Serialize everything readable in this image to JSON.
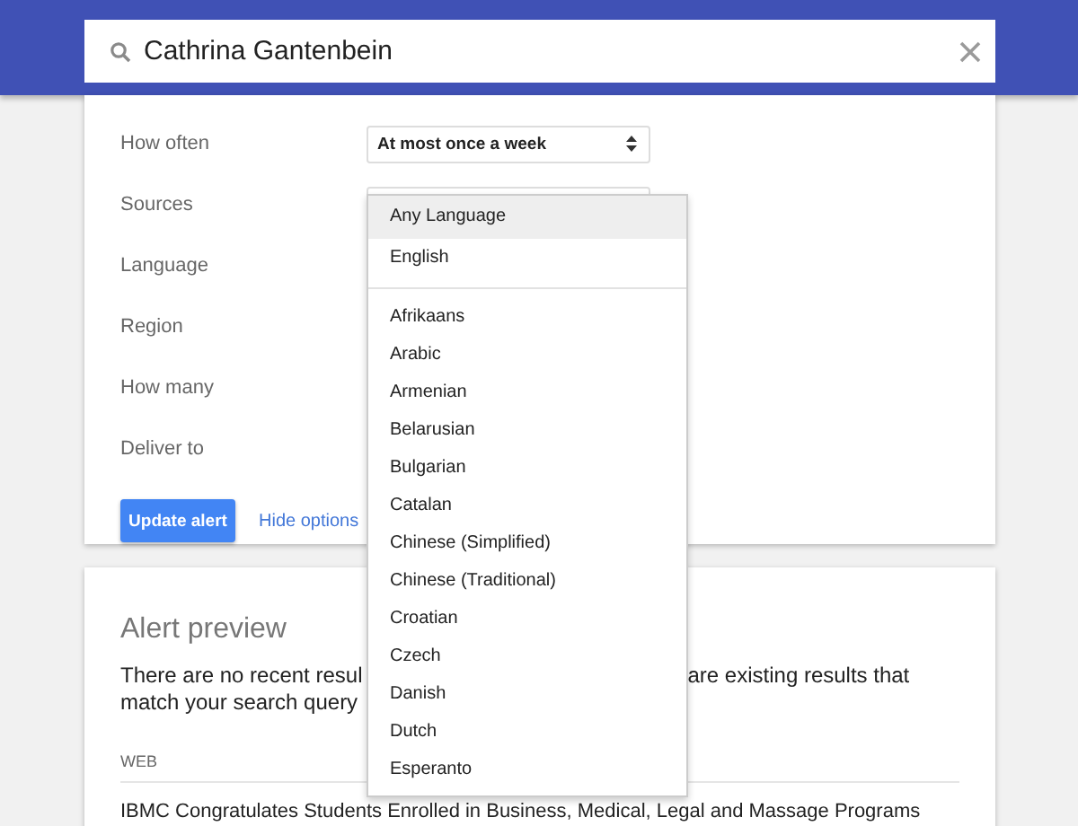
{
  "search": {
    "value": "Cathrina Gantenbein"
  },
  "options": [
    {
      "label": "How often",
      "value": "At most once a week"
    },
    {
      "label": "Sources"
    },
    {
      "label": "Language"
    },
    {
      "label": "Region"
    },
    {
      "label": "How many"
    },
    {
      "label": "Deliver to"
    }
  ],
  "update_button": "Update alert",
  "hide_link": "Hide options",
  "language_menu": {
    "top": [
      {
        "label": "Any Language",
        "selected": true
      },
      {
        "label": "English",
        "selected": false
      }
    ],
    "items": [
      {
        "label": "Afrikaans",
        "selected": false
      },
      {
        "label": "Arabic",
        "selected": false
      },
      {
        "label": "Armenian",
        "selected": false
      },
      {
        "label": "Belarusian",
        "selected": false
      },
      {
        "label": "Bulgarian",
        "selected": false
      },
      {
        "label": "Catalan",
        "selected": false
      },
      {
        "label": "Chinese (Simplified)",
        "selected": false
      },
      {
        "label": "Chinese (Traditional)",
        "selected": false
      },
      {
        "label": "Croatian",
        "selected": false
      },
      {
        "label": "Czech",
        "selected": false
      },
      {
        "label": "Danish",
        "selected": false
      },
      {
        "label": "Dutch",
        "selected": false
      },
      {
        "label": "Esperanto",
        "selected": false
      }
    ]
  },
  "preview": {
    "title": "Alert preview",
    "message_left": [
      "There are no recent resul",
      "match your search query"
    ],
    "message_right": [
      "are existing results that"
    ],
    "section": "WEB",
    "results": [
      "IBMC Congratulates Students Enrolled in Business, Medical, Legal and Massage Programs"
    ]
  }
}
